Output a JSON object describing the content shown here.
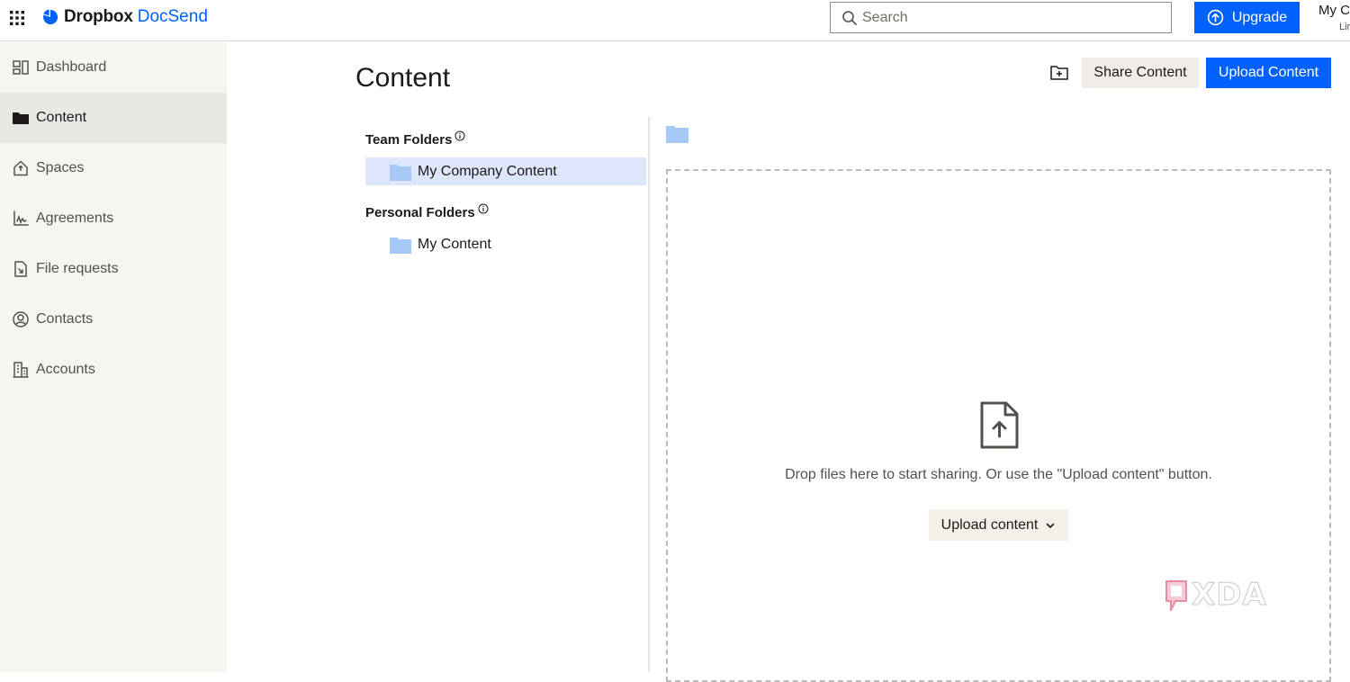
{
  "header": {
    "brand": "Dropbox",
    "product": "DocSend",
    "search_placeholder": "Search",
    "upgrade_label": "Upgrade",
    "account_name": "My C",
    "account_sub": "Lir"
  },
  "sidebar": {
    "items": [
      {
        "label": "Dashboard",
        "icon": "dashboard-icon"
      },
      {
        "label": "Content",
        "icon": "folder-icon"
      },
      {
        "label": "Spaces",
        "icon": "spaces-icon"
      },
      {
        "label": "Agreements",
        "icon": "agreements-icon"
      },
      {
        "label": "File requests",
        "icon": "file-request-icon"
      },
      {
        "label": "Contacts",
        "icon": "contacts-icon"
      },
      {
        "label": "Accounts",
        "icon": "accounts-icon"
      }
    ]
  },
  "main": {
    "title": "Content",
    "share_label": "Share Content",
    "upload_label": "Upload Content",
    "tree": {
      "team_heading": "Team Folders",
      "team_items": [
        "My Company Content"
      ],
      "personal_heading": "Personal Folders",
      "personal_items": [
        "My Content"
      ]
    },
    "dropzone": {
      "message": "Drop files here to start sharing. Or use the \"Upload content\" button.",
      "button_label": "Upload content"
    }
  },
  "watermark": {
    "text": "XDA"
  },
  "colors": {
    "accent": "#0061fe",
    "sidebar_bg": "#f7f5f2",
    "active_bg": "#e9e7e3",
    "selected_bg": "#dde6fb",
    "folder": "#a5c8f5"
  }
}
